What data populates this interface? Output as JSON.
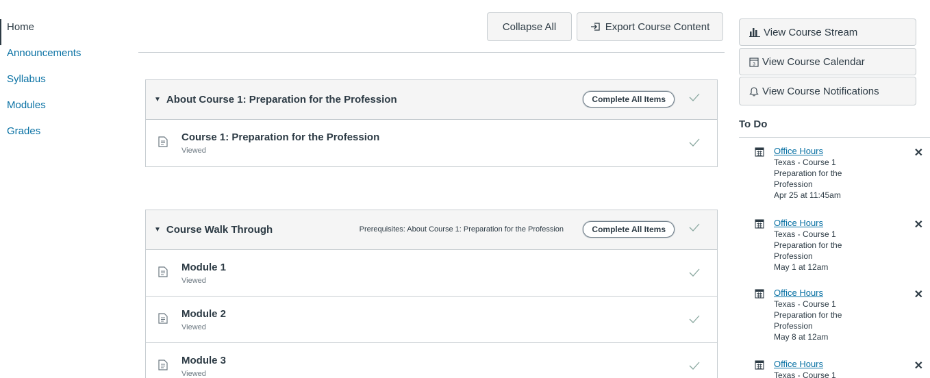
{
  "nav": {
    "items": [
      {
        "label": "Home",
        "active": true
      },
      {
        "label": "Announcements"
      },
      {
        "label": "Syllabus"
      },
      {
        "label": "Modules"
      },
      {
        "label": "Grades"
      }
    ]
  },
  "toolbar": {
    "collapse_label": "Collapse All",
    "export_label": "Export Course Content"
  },
  "modules": [
    {
      "title": "About Course 1: Preparation for the Profession",
      "complete_label": "Complete All Items",
      "items": [
        {
          "title": "Course 1: Preparation for the Profession",
          "status": "Viewed"
        }
      ]
    },
    {
      "title": "Course Walk Through",
      "prerequisites": "Prerequisites: About Course 1: Preparation for the Profession",
      "complete_label": "Complete All Items",
      "items": [
        {
          "title": "Module 1",
          "status": "Viewed"
        },
        {
          "title": "Module 2",
          "status": "Viewed"
        },
        {
          "title": "Module 3",
          "status": "Viewed"
        }
      ]
    }
  ],
  "sidebar": {
    "stream_label": "View Course Stream",
    "calendar_label": "View Course Calendar",
    "notifications_label": "View Course Notifications",
    "todo_title": "To Do",
    "todo": [
      {
        "link": "Office Hours",
        "course": "Texas - Course 1 Preparation for the Profession",
        "date": "Apr 25 at 11:45am"
      },
      {
        "link": "Office Hours",
        "course": "Texas - Course 1 Preparation for the Profession",
        "date": "May 1 at 12am"
      },
      {
        "link": "Office Hours",
        "course": "Texas - Course 1 Preparation for the Profession",
        "date": "May 8 at 12am"
      },
      {
        "link": "Office Hours",
        "course": "Texas - Course 1",
        "date": ""
      }
    ]
  },
  "colors": {
    "link": "#0770a3",
    "text": "#2d3b45",
    "check": "#8aa8a0",
    "header_bg": "#f5f5f5"
  }
}
